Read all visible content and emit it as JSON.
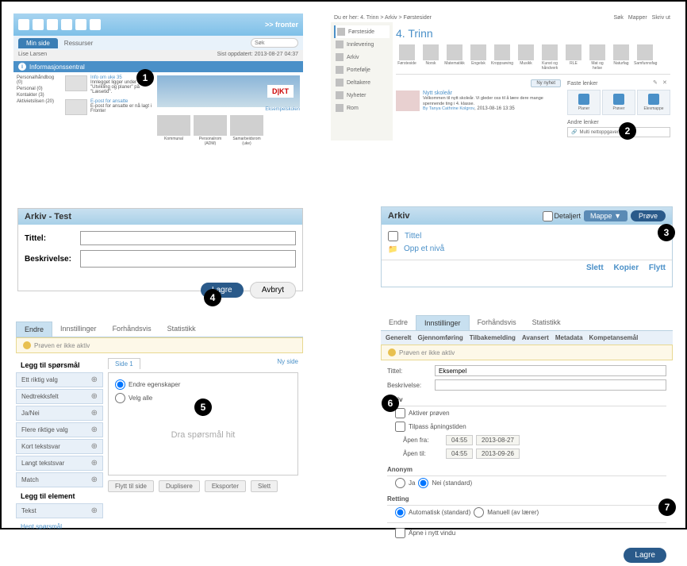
{
  "panel1": {
    "brand": ">> fronter",
    "tab1": "Min side",
    "tab2": "Ressurser",
    "searchPlaceholder": "Søk",
    "breadcrumb": "Lise Larsen",
    "updated": "Sist oppdatert: 2013-08-27 04:37",
    "infoTitle": "Informasjonssentral",
    "side": [
      "Personalhåndbog (0)",
      "Personal (0)",
      "Kontakter (3)",
      "Aktivietslisen (20)"
    ],
    "item1Title": "Info om uke 35",
    "item1Body": "Innlegget ligger under \"Utvikling og planer\" på \"Læsetid\".",
    "item2Title": "E-post for ansatte",
    "item2Body": "E-post for ansatte er nå lagt i Fronter",
    "dikt": "D|KT",
    "heroSub": "Eksempelskolen",
    "thumbs": [
      "Kommunal",
      "Personalrom (ADM)",
      "Samarbeidsrom (uke)"
    ]
  },
  "panel2": {
    "breadcrumb": "Du er her: 4. Trinn > Arkiv > Førstesider",
    "bcSok": "Søk",
    "bcMapper": "Mapper",
    "bcSkriv": "Skriv ut",
    "nav": [
      "Førsteside",
      "Innlevering",
      "Arkiv",
      "Portefølje",
      "Deltakere",
      "Nyheter",
      "Rom"
    ],
    "title": "4. Trinn",
    "subjects": [
      "Førsteside",
      "Norsk",
      "Matematikk",
      "Engelsk",
      "Kroppsøving",
      "Musikk",
      "Kunst og håndverk",
      "RLE",
      "Mat og helse",
      "Naturfag",
      "Samfunnsfag"
    ],
    "nyNyhet": "Ny nyhet",
    "newsTitle": "Nytt skoleår",
    "newsBody": "Velkommen til nytt skoleår. Vi gleder oss til å lære dere mange spennende ting i 4. klasse.",
    "newsAuthor": "By Tanya Cathrine Kolgrov",
    "newsDate": ", 2013-08-16 13:35",
    "fasteLenker": "Faste lenker",
    "cards": [
      "Planer",
      "Prøver",
      "Elevmappe"
    ],
    "andreLenker": "Andre lenker",
    "multi": "Multi nettoppgaver"
  },
  "panel3": {
    "header": "Arkiv - Test",
    "tittel": "Tittel:",
    "beskrivelse": "Beskrivelse:",
    "lagre": "Lagre",
    "avbryt": "Avbryt"
  },
  "panel4": {
    "header": "Arkiv",
    "detaljert": "Detaljert",
    "mappe": "Mappe ▼",
    "prove": "Prøve",
    "colTittel": "Tittel",
    "opp": "Opp et nivå",
    "slett": "Slett",
    "kopier": "Kopier",
    "flytt": "Flytt"
  },
  "panel5": {
    "tabs": [
      "Endre",
      "Innstillinger",
      "Forhåndsvis",
      "Statistikk"
    ],
    "warn": "Prøven er ikke aktiv",
    "leggSporsmal": "Legg til spørsmål",
    "qtypes": [
      "Ett riktig valg",
      "Nedtrekksfelt",
      "Ja/Nei",
      "Flere riktige valg",
      "Kort tekstsvar",
      "Langt tekstsvar",
      "Match"
    ],
    "leggElement": "Legg til element",
    "tekst": "Tekst",
    "hent": "Hent spørsmål",
    "side1": "Side 1",
    "nySide": "Ny side",
    "endreEg": "Endre egenskaper",
    "velgAlle": "Velg alle",
    "dropHint": "Dra spørsmål hit",
    "bbtns": [
      "Flytt til side",
      "Duplisere",
      "Eksporter",
      "Slett"
    ]
  },
  "panel6": {
    "tabs": [
      "Endre",
      "Innstillinger",
      "Forhåndsvis",
      "Statistikk"
    ],
    "subtabs": [
      "Generelt",
      "Gjennomføring",
      "Tilbakemelding",
      "Avansert",
      "Metadata",
      "Kompetansemål"
    ],
    "warn": "Prøven er ikke aktiv",
    "tittel": "Tittel:",
    "tittelVal": "Eksempel",
    "beskrivelse": "Beskrivelse:",
    "aktiv": "Aktiv",
    "aktiverProven": "Aktiver prøven",
    "tilpass": "Tilpass åpningstiden",
    "apenFra": "Åpen fra:",
    "apenTil": "Åpen til:",
    "t1": "04:55",
    "d1": "2013-08-27",
    "t2": "04:55",
    "d2": "2013-09-26",
    "anonym": "Anonym",
    "ja": "Ja",
    "nei": "Nei (standard)",
    "retting": "Retting",
    "auto": "Automatisk (standard)",
    "manuell": "Manuell (av lærer)",
    "apneNytt": "Åpne i nytt vindu",
    "lagre": "Lagre"
  },
  "badges": [
    "1",
    "2",
    "3",
    "4",
    "5",
    "6",
    "7"
  ]
}
